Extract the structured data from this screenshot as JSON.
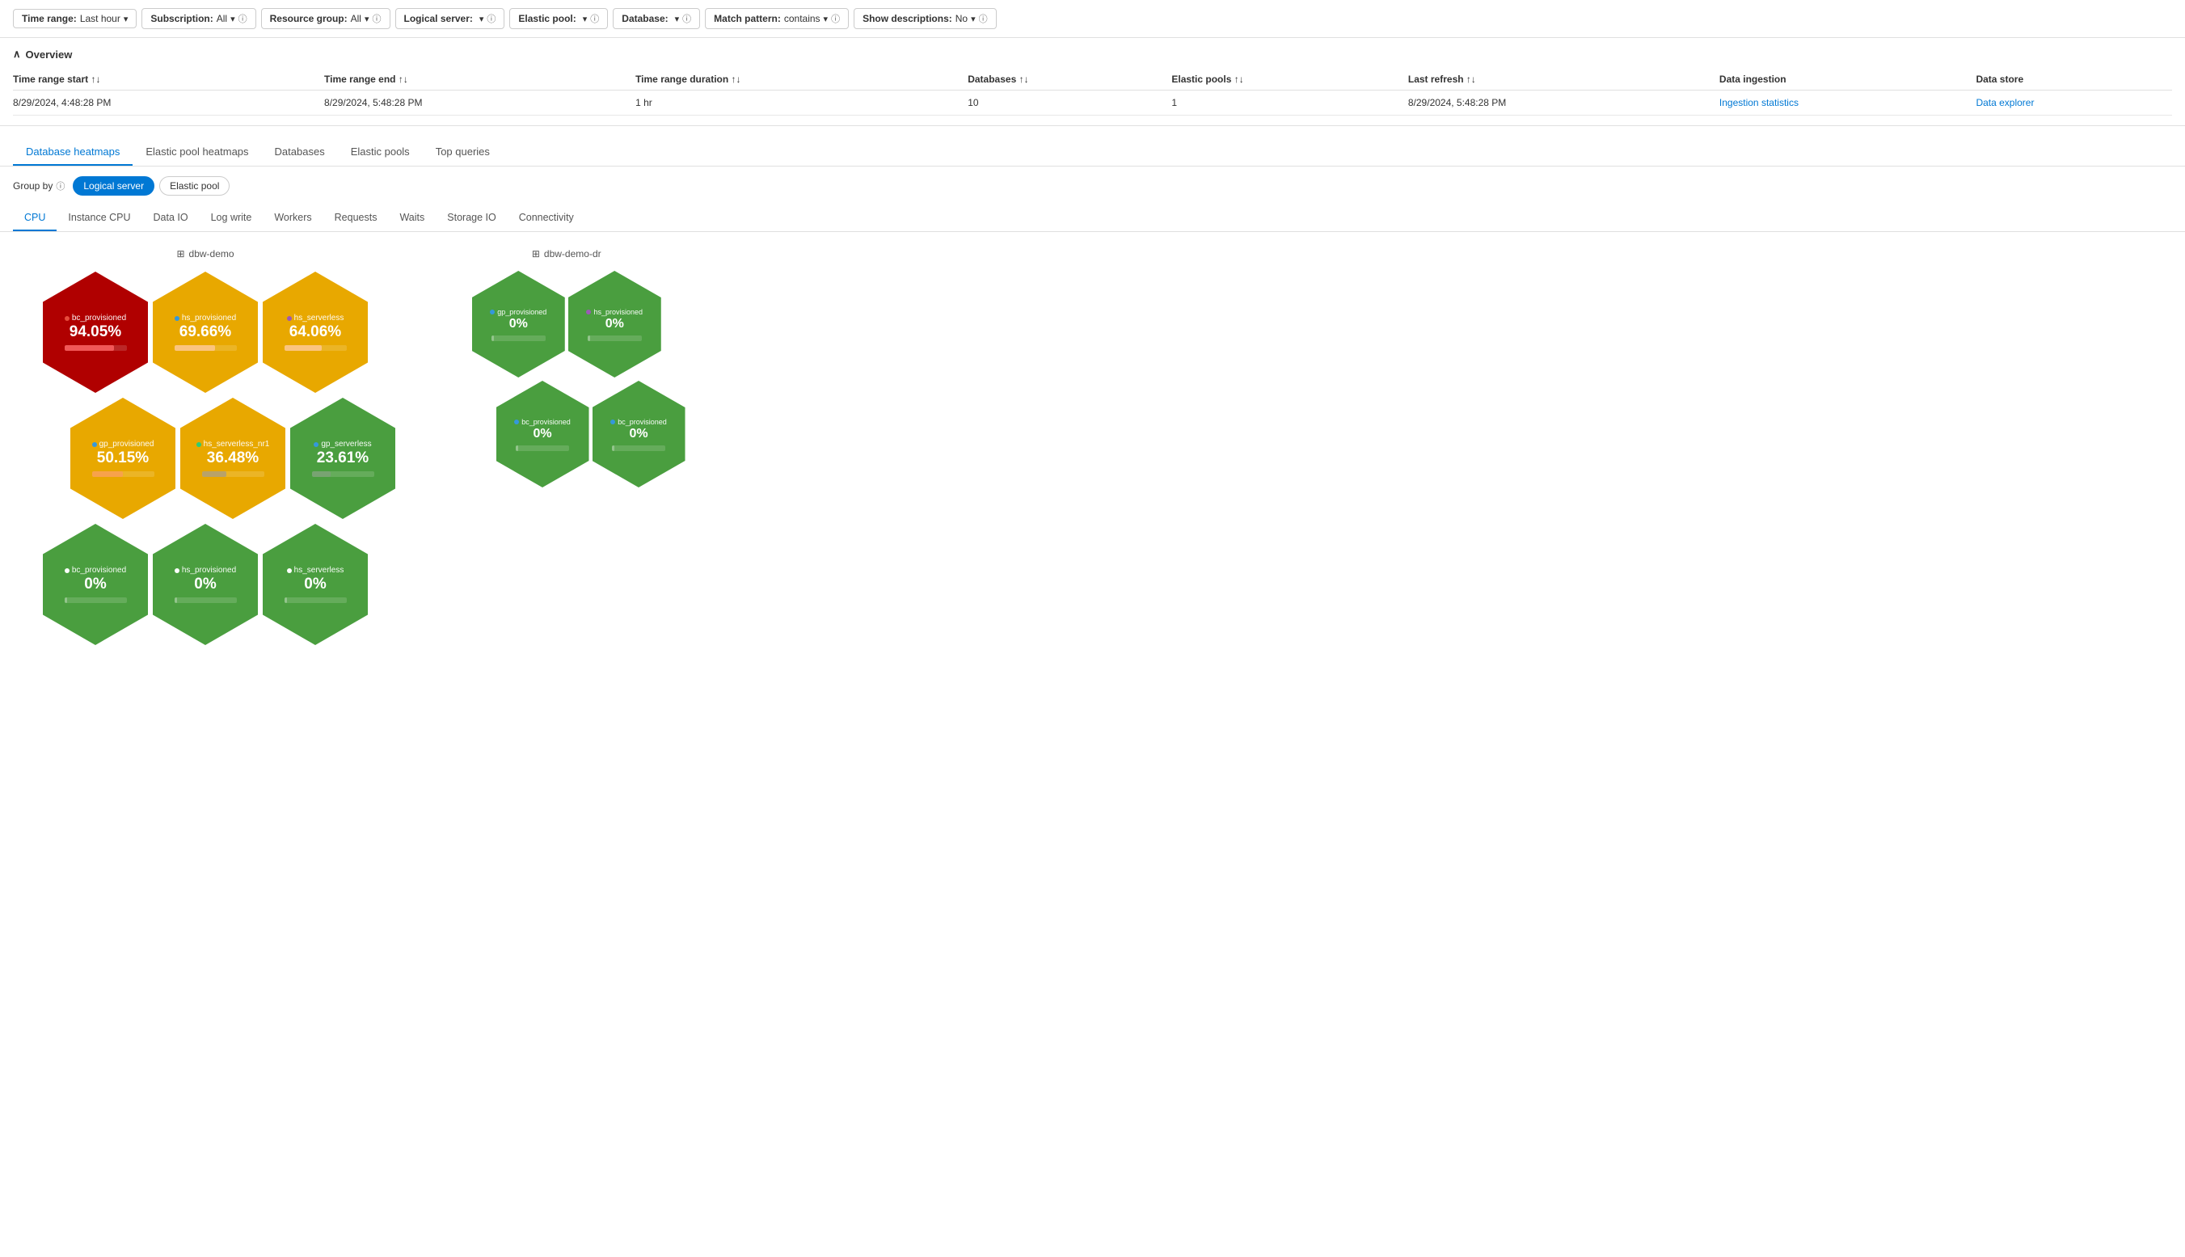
{
  "filterBar": {
    "filters": [
      {
        "label": "Time range:",
        "value": "Last hour",
        "hasInfo": false,
        "hasChevron": true
      },
      {
        "label": "Subscription:",
        "value": "All",
        "hasInfo": true,
        "hasChevron": true
      },
      {
        "label": "Resource group:",
        "value": "All",
        "hasInfo": true,
        "hasChevron": true
      },
      {
        "label": "Logical server:",
        "value": "<unset>",
        "hasInfo": true,
        "hasChevron": true
      },
      {
        "label": "Elastic pool:",
        "value": "<unset>",
        "hasInfo": true,
        "hasChevron": true
      },
      {
        "label": "Database:",
        "value": "<unset>",
        "hasInfo": true,
        "hasChevron": true
      },
      {
        "label": "Match pattern:",
        "value": "contains",
        "hasInfo": true,
        "hasChevron": true
      },
      {
        "label": "Show descriptions:",
        "value": "No",
        "hasInfo": true,
        "hasChevron": true
      }
    ]
  },
  "overview": {
    "title": "Overview",
    "columns": [
      "Time range start",
      "Time range end",
      "Time range duration",
      "Databases",
      "Elastic pools",
      "Last refresh",
      "Data ingestion",
      "Data store"
    ],
    "row": {
      "timeStart": "8/29/2024, 4:48:28 PM",
      "timeEnd": "8/29/2024, 5:48:28 PM",
      "duration": "1 hr",
      "databases": "10",
      "elasticPools": "1",
      "lastRefresh": "8/29/2024, 5:48:28 PM",
      "dataIngestion": "Ingestion statistics",
      "dataStore": "Data explorer"
    }
  },
  "mainTabs": [
    {
      "id": "db-heatmaps",
      "label": "Database heatmaps",
      "active": true
    },
    {
      "id": "ep-heatmaps",
      "label": "Elastic pool heatmaps",
      "active": false
    },
    {
      "id": "databases",
      "label": "Databases",
      "active": false
    },
    {
      "id": "elastic-pools",
      "label": "Elastic pools",
      "active": false
    },
    {
      "id": "top-queries",
      "label": "Top queries",
      "active": false
    }
  ],
  "groupBy": {
    "label": "Group by",
    "options": [
      {
        "id": "logical-server",
        "label": "Logical server",
        "active": true
      },
      {
        "id": "elastic-pool",
        "label": "Elastic pool",
        "active": false
      }
    ]
  },
  "metricTabs": [
    {
      "id": "cpu",
      "label": "CPU",
      "active": true
    },
    {
      "id": "instance-cpu",
      "label": "Instance CPU",
      "active": false
    },
    {
      "id": "data-io",
      "label": "Data IO",
      "active": false
    },
    {
      "id": "log-write",
      "label": "Log write",
      "active": false
    },
    {
      "id": "workers",
      "label": "Workers",
      "active": false
    },
    {
      "id": "requests",
      "label": "Requests",
      "active": false
    },
    {
      "id": "waits",
      "label": "Waits",
      "active": false
    },
    {
      "id": "storage-io",
      "label": "Storage IO",
      "active": false
    },
    {
      "id": "connectivity",
      "label": "Connectivity",
      "active": false
    }
  ],
  "clusters": [
    {
      "id": "dbw-demo",
      "label": "dbw-demo",
      "rows": [
        [
          {
            "name": "bc_provisioned",
            "pct": "94.05%",
            "color": "red",
            "dotColor": "#e74c3c",
            "barColor": "rgba(255,100,100,0.8)",
            "barWidth": 80
          },
          {
            "name": "hs_provisioned",
            "pct": "69.66%",
            "color": "yellow",
            "dotColor": "#3498db",
            "barColor": "rgba(255,200,150,0.8)",
            "barWidth": 65
          },
          {
            "name": "hs_serverless",
            "pct": "64.06%",
            "color": "yellow",
            "dotColor": "#9b59b6",
            "barColor": "rgba(255,200,150,0.8)",
            "barWidth": 60
          }
        ],
        [
          {
            "name": "gp_provisioned",
            "pct": "50.15%",
            "color": "yellow",
            "dotColor": "#3498db",
            "barColor": "rgba(255,150,100,0.6)",
            "barWidth": 50
          },
          {
            "name": "hs_serverless_nr1",
            "pct": "36.48%",
            "color": "yellow",
            "dotColor": "#2ecc71",
            "barColor": "rgba(150,150,150,0.6)",
            "barWidth": 40
          },
          {
            "name": "gp_serverless",
            "pct": "23.61%",
            "color": "green",
            "dotColor": "#3498db",
            "barColor": "rgba(150,150,150,0.4)",
            "barWidth": 30
          }
        ],
        [
          {
            "name": "bc_provisioned",
            "pct": "0%",
            "color": "green",
            "dotColor": "#fff",
            "barColor": "rgba(255,255,255,0.3)",
            "barWidth": 5
          },
          {
            "name": "hs_provisioned",
            "pct": "0%",
            "color": "green",
            "dotColor": "#fff",
            "barColor": "rgba(255,255,255,0.3)",
            "barWidth": 5
          },
          {
            "name": "hs_serverless",
            "pct": "0%",
            "color": "green",
            "dotColor": "#fff",
            "barColor": "rgba(255,255,255,0.3)",
            "barWidth": 5
          }
        ]
      ]
    },
    {
      "id": "dbw-demo-dr",
      "label": "dbw-demo-dr",
      "rows": [
        [
          {
            "name": "gp_provisioned",
            "pct": "0%",
            "color": "green",
            "dotColor": "#3498db",
            "barColor": "rgba(255,255,255,0.3)",
            "barWidth": 5
          },
          {
            "name": "hs_provisioned",
            "pct": "0%",
            "color": "green",
            "dotColor": "#9b59b6",
            "barColor": "rgba(255,255,255,0.3)",
            "barWidth": 5
          }
        ],
        [
          {
            "name": "bc_provisioned",
            "pct": "0%",
            "color": "green",
            "dotColor": "#3498db",
            "barColor": "rgba(255,255,255,0.3)",
            "barWidth": 5
          },
          {
            "name": "bc_provisioned",
            "pct": "0%",
            "color": "green",
            "dotColor": "#3498db",
            "barColor": "rgba(255,255,255,0.3)",
            "barWidth": 5
          }
        ]
      ]
    }
  ],
  "icons": {
    "chevron_down": "▾",
    "sort_updown": "↑↓",
    "info": "ⓘ",
    "collapse": "∧",
    "db": "⊞"
  }
}
